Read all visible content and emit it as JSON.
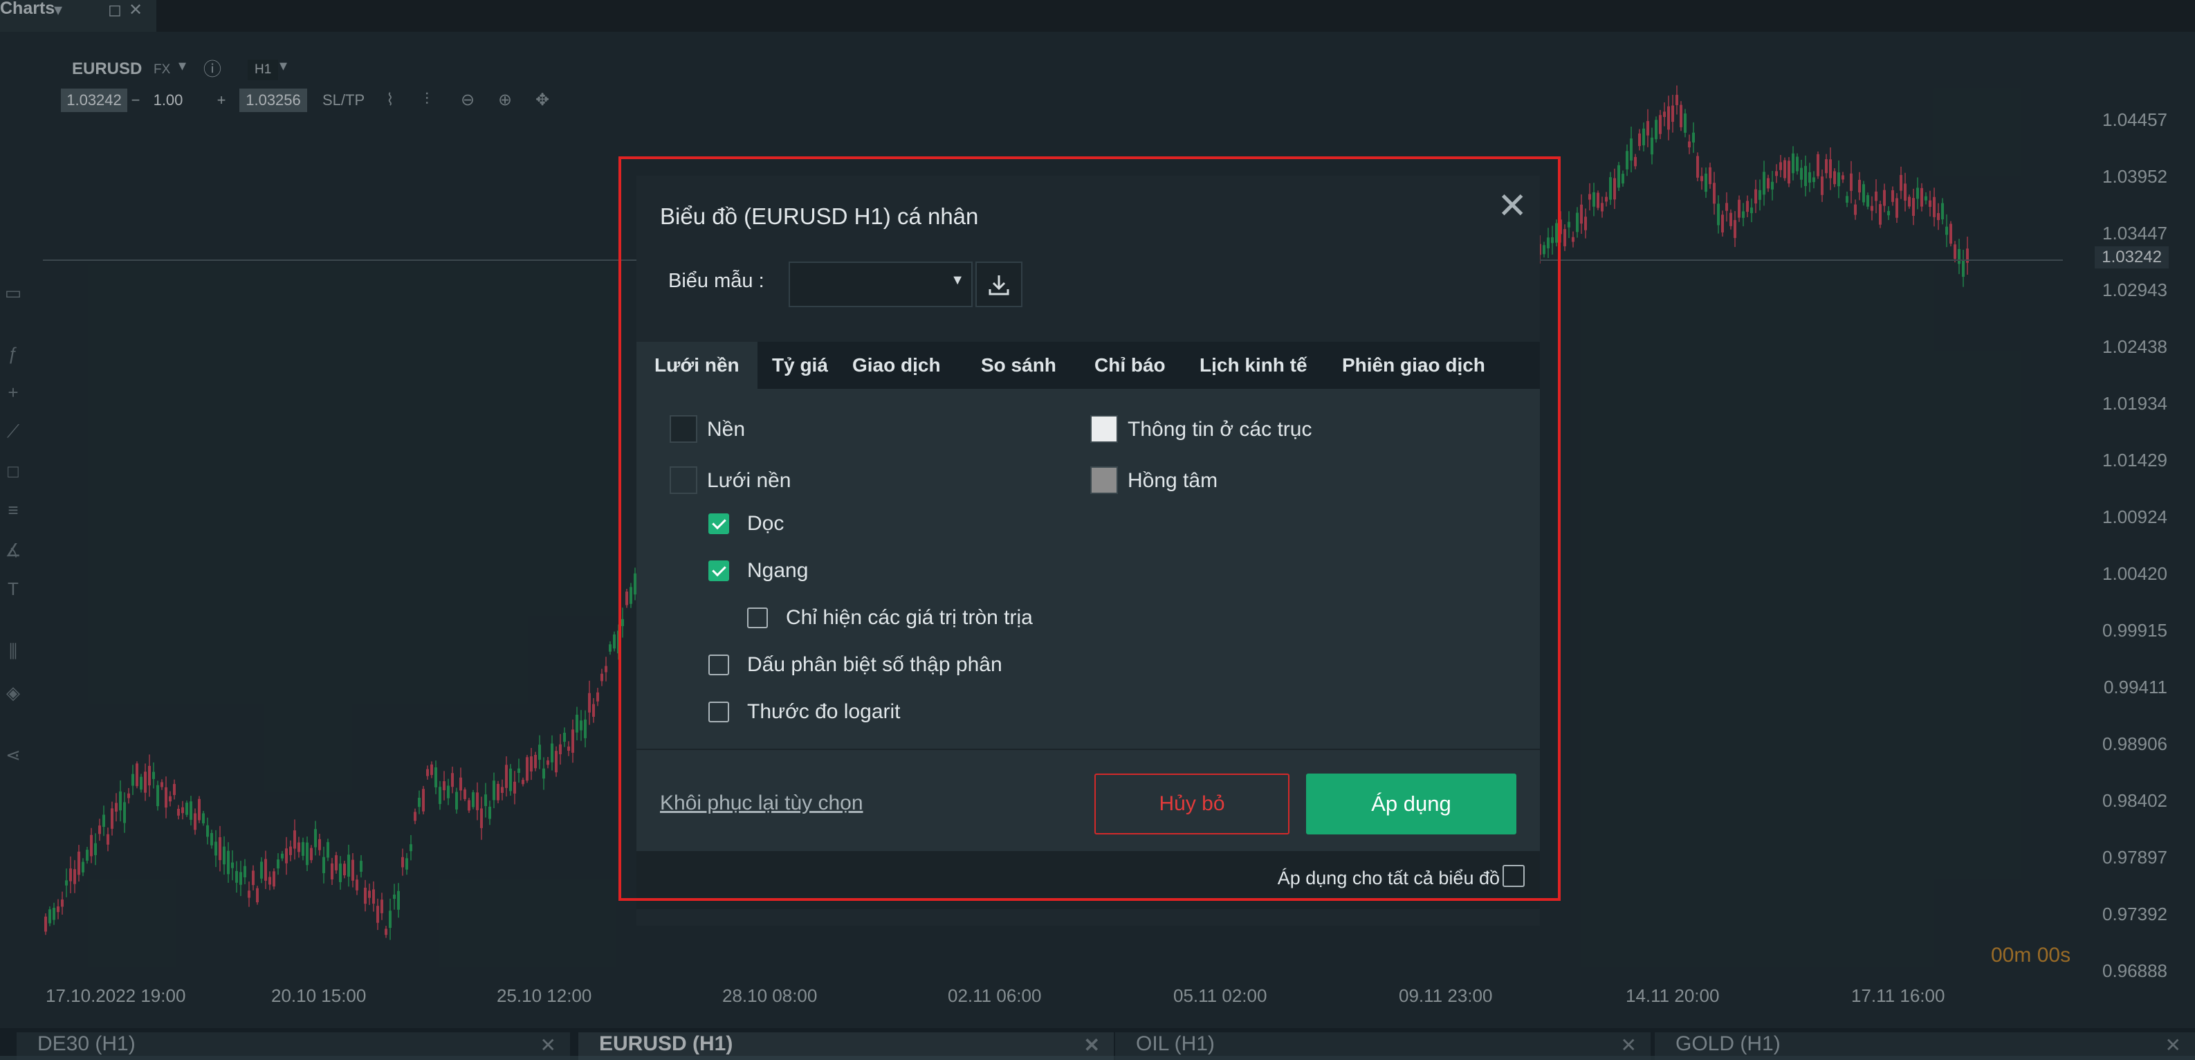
{
  "window": {
    "title": "Charts"
  },
  "chart": {
    "symbol": "EURUSD",
    "market": "FX",
    "timeframe": "H1",
    "bid": "1.03242",
    "lot": "1.00",
    "ask": "1.03256",
    "sltp_label": "SL/TP",
    "current_price": "1.03242",
    "countdown_min": "00",
    "countdown_min_unit": "m",
    "countdown_sec": "00",
    "countdown_sec_unit": "s",
    "price_labels": [
      "1.04457",
      "1.03952",
      "1.03447",
      "1.02943",
      "1.02438",
      "1.01934",
      "1.01429",
      "1.00924",
      "1.00420",
      "0.99915",
      "0.99411",
      "0.98906",
      "0.98402",
      "0.97897",
      "0.97392",
      "0.96888"
    ],
    "time_labels": [
      "17.10.2022 19:00",
      "20.10 15:00",
      "25.10 12:00",
      "28.10 08:00",
      "02.11 06:00",
      "05.11 02:00",
      "09.11 23:00",
      "14.11 20:00",
      "17.11 16:00"
    ]
  },
  "bottom_tabs": [
    {
      "label": "DE30 (H1)"
    },
    {
      "label": "EURUSD (H1)"
    },
    {
      "label": "OIL (H1)"
    },
    {
      "label": "GOLD (H1)"
    }
  ],
  "dialog": {
    "title": "Biểu đồ (EURUSD H1) cá nhân",
    "template_label": "Biểu mẫu :",
    "template_value": "",
    "tabs": [
      "Lưới nền",
      "Tỷ giá",
      "Giao dịch",
      "So sánh",
      "Chỉ báo",
      "Lịch kinh tế",
      "Phiên giao dịch"
    ],
    "options": {
      "background": "Nền",
      "grid": "Lưới nền",
      "vertical": "Dọc",
      "horizontal": "Ngang",
      "round_values": "Chỉ hiện các giá trị tròn trịa",
      "decimal_separator": "Dấu phân biệt số thập phân",
      "log_scale": "Thước đo logarit",
      "axis_info": "Thông tin ở các trục",
      "crosshair": "Hồng tâm"
    },
    "checked": {
      "vertical": true,
      "horizontal": true,
      "round_values": false,
      "decimal_separator": false,
      "log_scale": false,
      "apply_all": false
    },
    "reset_label": "Khôi phục lại tùy chọn",
    "cancel_label": "Hủy bỏ",
    "apply_label": "Áp dụng",
    "apply_all_label": "Áp dụng cho tất cả biểu đồ"
  },
  "colors": {
    "accent_green": "#18a76f",
    "cancel_red": "#e23b3b",
    "up_candle": "#26a65b",
    "down_candle": "#d2465a"
  }
}
